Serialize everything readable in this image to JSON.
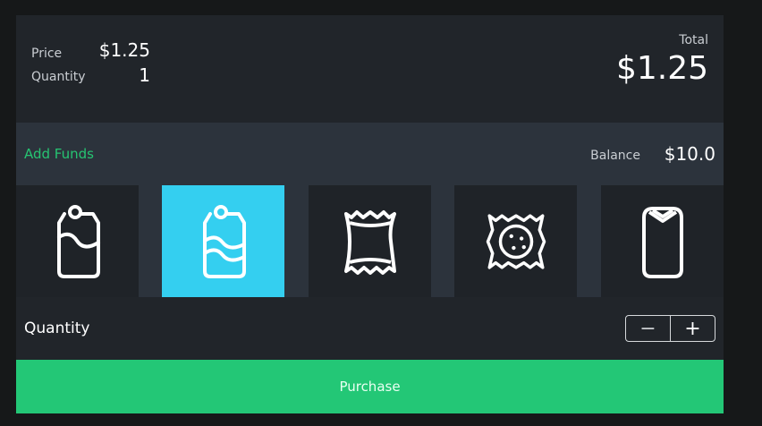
{
  "summary": {
    "price_label": "Price",
    "price_value": "$1.25",
    "quantity_label": "Quantity",
    "quantity_value": "1",
    "total_label": "Total",
    "total_value": "$1.25"
  },
  "funds": {
    "add_label": "Add Funds",
    "balance_label": "Balance",
    "balance_value": "$10.0"
  },
  "products": [
    {
      "icon": "soda-can-icon",
      "selected": false
    },
    {
      "icon": "soda-can-icon",
      "selected": true
    },
    {
      "icon": "chips-bag-icon",
      "selected": false
    },
    {
      "icon": "cookie-pack-icon",
      "selected": false
    },
    {
      "icon": "snack-bar-icon",
      "selected": false
    }
  ],
  "quantity_row": {
    "label": "Quantity",
    "minus": "−",
    "plus": "+"
  },
  "purchase_label": "Purchase",
  "colors": {
    "accent_green": "#23c776",
    "selected_tile": "#34cff0",
    "background": "#21252a"
  }
}
